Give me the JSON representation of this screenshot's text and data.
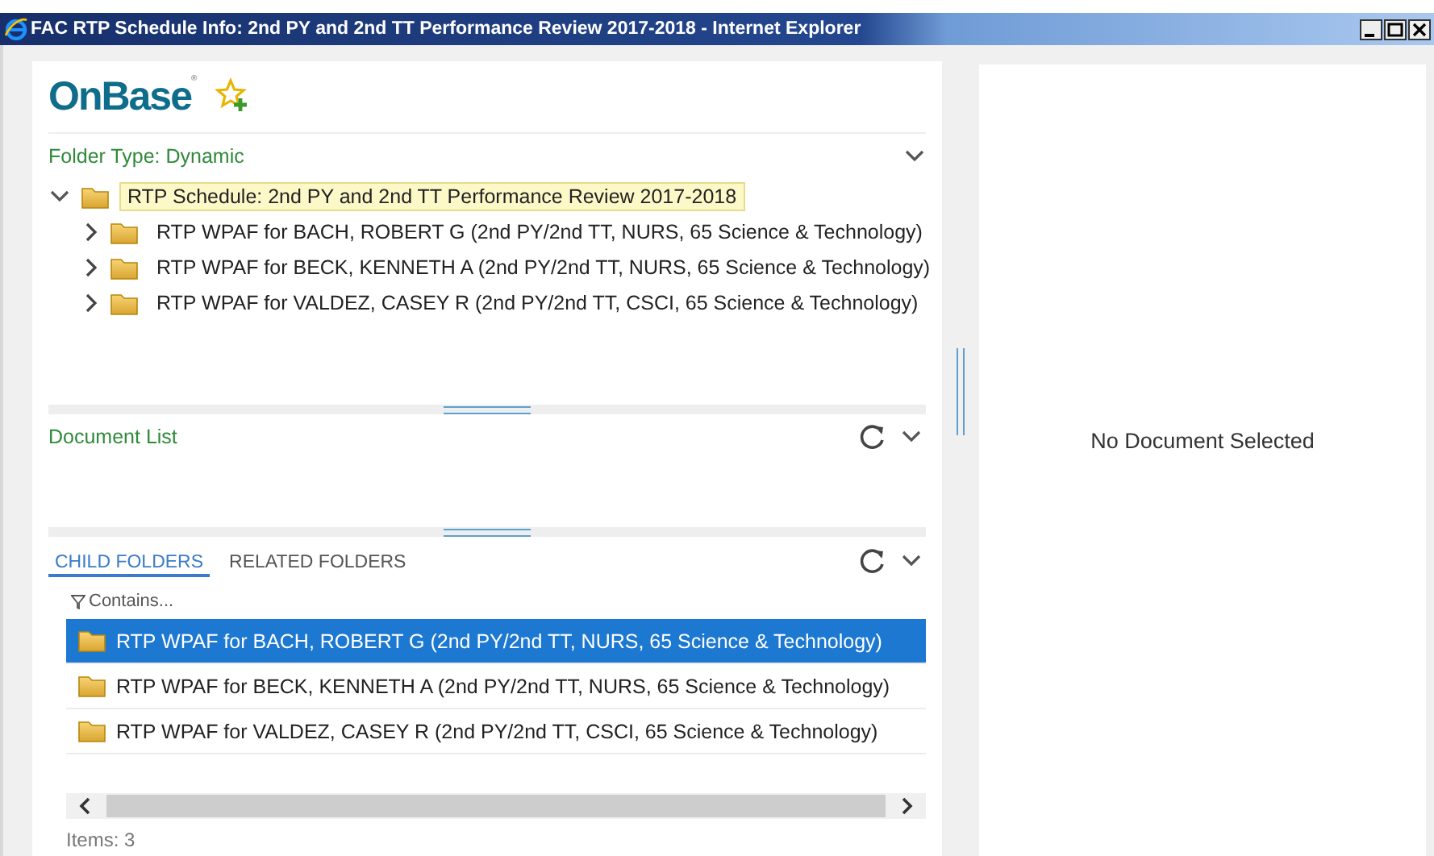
{
  "window": {
    "title": "FAC RTP Schedule Info: 2nd PY and 2nd TT Performance Review 2017-2018 - Internet Explorer"
  },
  "header": {
    "logo": "OnBase",
    "logo_mark": "®"
  },
  "folder_panel": {
    "title": "Folder Type: Dynamic",
    "tree": [
      {
        "label": "RTP Schedule: 2nd PY and 2nd TT Performance Review 2017-2018",
        "expanded": true,
        "selected": true,
        "children": [
          {
            "label": "RTP WPAF for BACH, ROBERT G (2nd PY/2nd TT, NURS, 65 Science & Technology)",
            "expanded": false,
            "selected": false
          },
          {
            "label": "RTP WPAF for BECK, KENNETH A (2nd PY/2nd TT, NURS, 65 Science & Technology)",
            "expanded": false,
            "selected": false
          },
          {
            "label": "RTP WPAF for VALDEZ, CASEY R (2nd PY/2nd TT, CSCI, 65 Science & Technology)",
            "expanded": false,
            "selected": false
          }
        ]
      }
    ]
  },
  "document_list": {
    "title": "Document List"
  },
  "folders_panel": {
    "tabs": [
      {
        "label": "CHILD FOLDERS",
        "selected": true
      },
      {
        "label": "RELATED FOLDERS",
        "selected": false
      }
    ],
    "filter": {
      "placeholder": "Contains..."
    },
    "rows": [
      {
        "label": "RTP WPAF for BACH, ROBERT G (2nd PY/2nd TT, NURS, 65 Science & Technology)",
        "selected": true
      },
      {
        "label": "RTP WPAF for BECK, KENNETH A (2nd PY/2nd TT, NURS, 65 Science & Technology)",
        "selected": false
      },
      {
        "label": "RTP WPAF for VALDEZ, CASEY R (2nd PY/2nd TT, CSCI, 65 Science & Technology)",
        "selected": false
      }
    ],
    "items_count": "Items: 3"
  },
  "viewer": {
    "message": "No Document Selected"
  }
}
